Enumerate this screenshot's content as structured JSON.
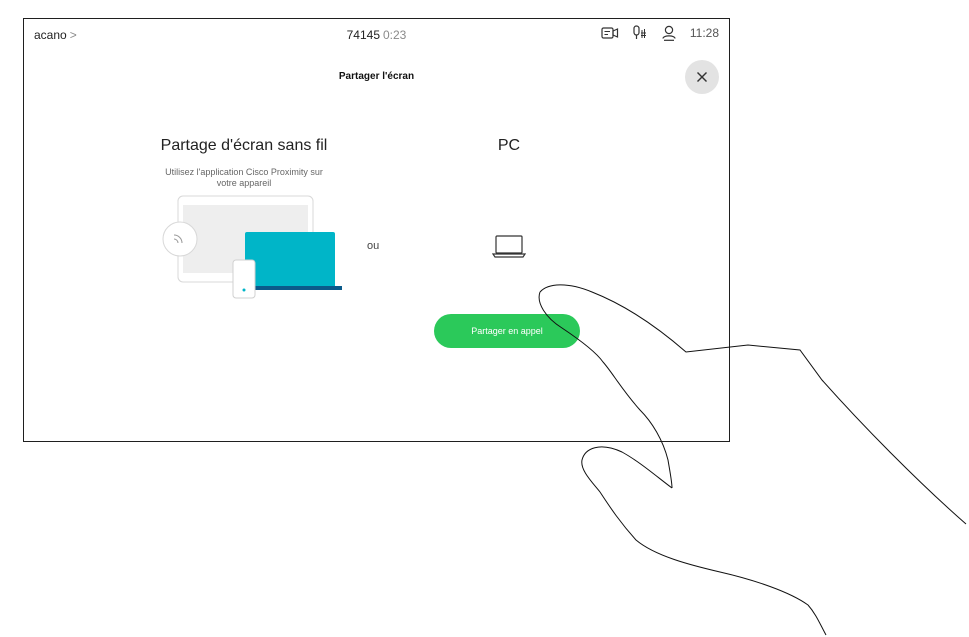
{
  "status_bar": {
    "breadcrumb": "acano",
    "breadcrumb_chevron": ">",
    "call_number": "74145",
    "call_duration": "0:23",
    "icons": [
      "camera-icon",
      "microphone-icon",
      "participants-icon"
    ],
    "time": "11:28"
  },
  "page": {
    "title": "Partager l'écran",
    "close_icon": "close-icon"
  },
  "wireless": {
    "title": "Partage d'écran sans fil",
    "description_line1": "Utilisez l'application Cisco Proximity sur",
    "description_line2": "votre appareil"
  },
  "separator": "ou",
  "pc": {
    "title": "PC",
    "icon": "laptop-icon"
  },
  "share_button": {
    "label": "Partager en appel"
  },
  "colors": {
    "accent_green": "#2bc95a",
    "laptop_teal": "#00b5c8",
    "laptop_base": "#0b5a8a",
    "close_bg": "#e3e3e3"
  }
}
